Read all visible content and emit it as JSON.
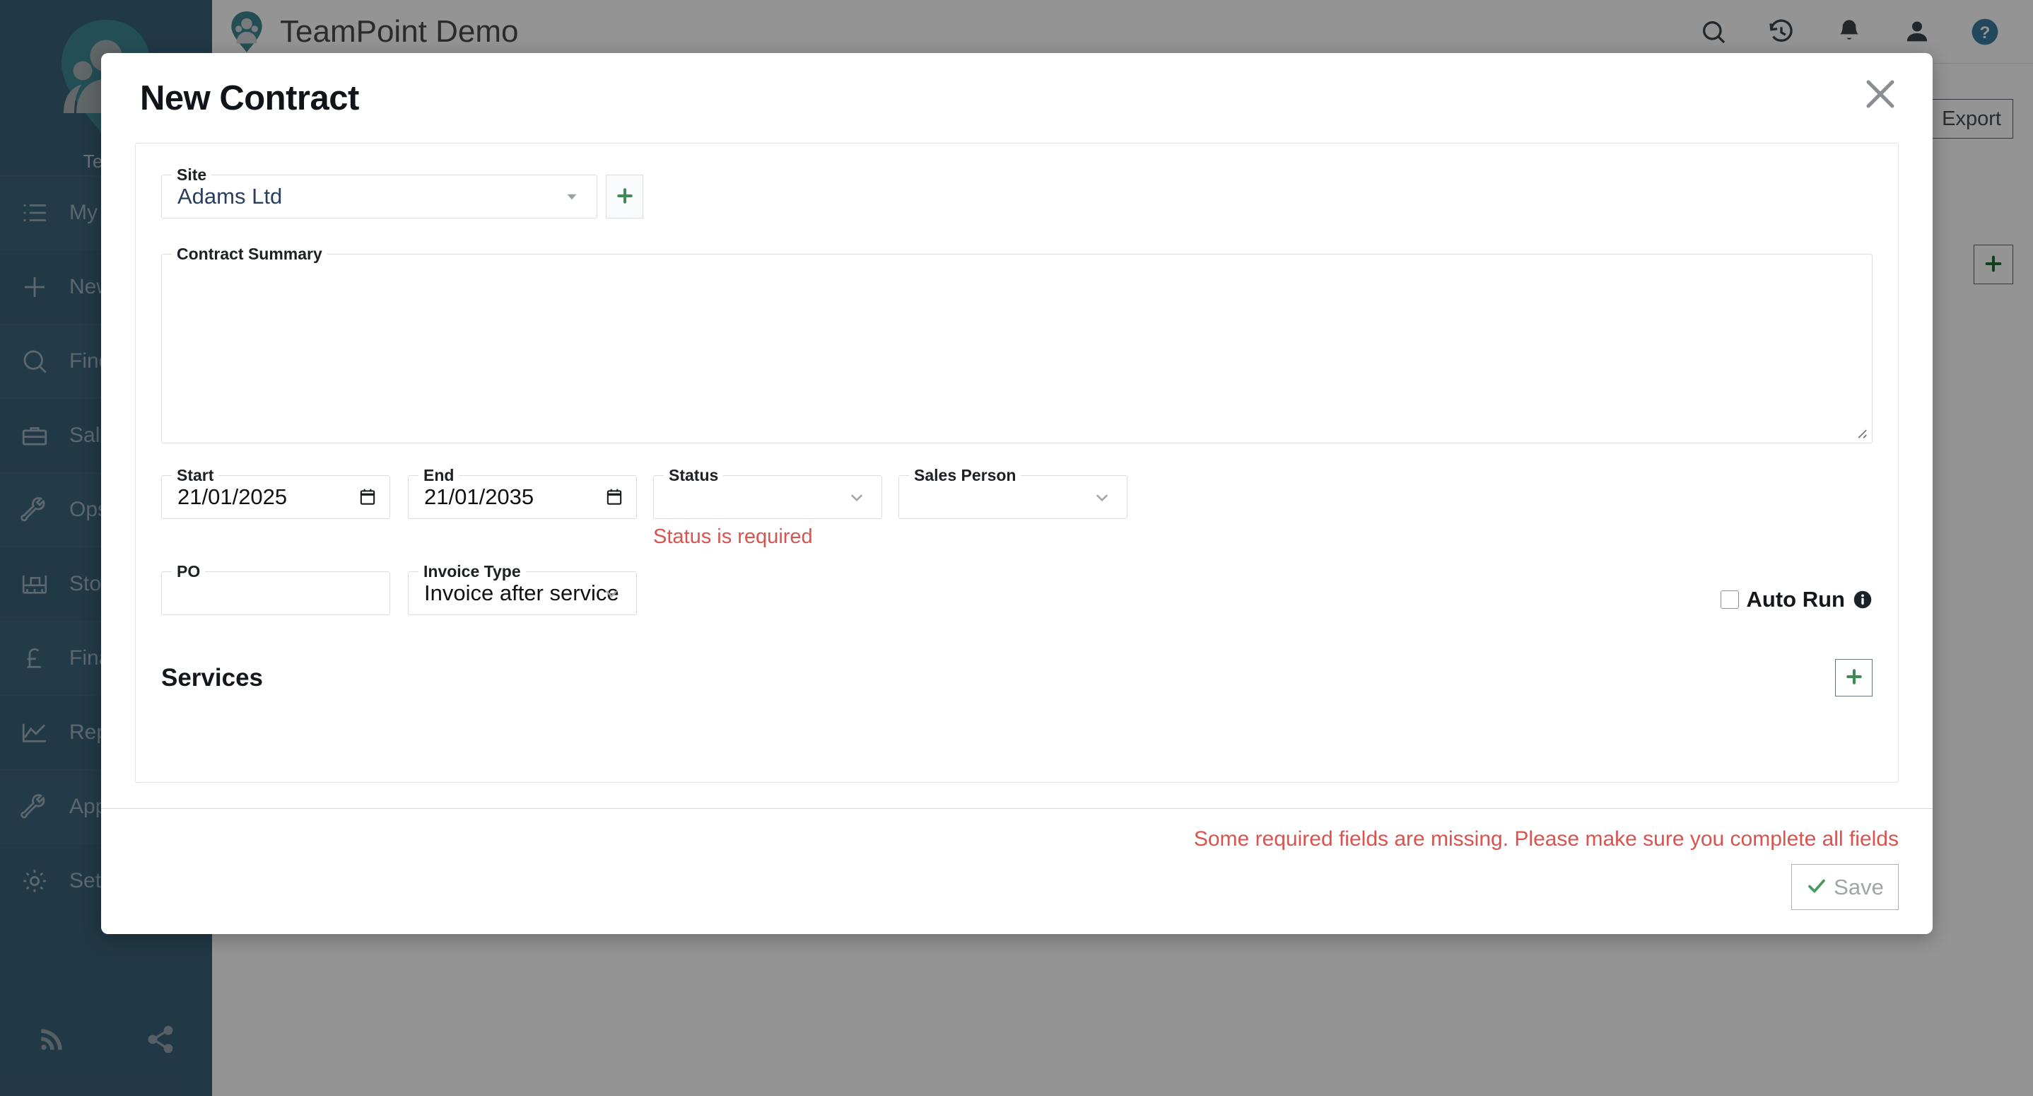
{
  "app": {
    "brand_name": "Team",
    "title": "TeamPoint Demo",
    "logo_icon": "people-pin-logo",
    "header_icons": [
      {
        "name": "search-icon",
        "label": "Search"
      },
      {
        "name": "history-icon",
        "label": "History"
      },
      {
        "name": "notifications-bell-icon",
        "label": "Notifications"
      },
      {
        "name": "user-account-icon",
        "label": "Account"
      },
      {
        "name": "help-icon",
        "label": "Help"
      }
    ],
    "accent_teal": "#3f8794",
    "sidebar_bg": "#3a6179",
    "help_icon_color": "#3a7ca0"
  },
  "sidebar": {
    "items": [
      {
        "label": "My N",
        "icon": "list-icon"
      },
      {
        "label": "New",
        "icon": "plus-icon"
      },
      {
        "label": "Find",
        "icon": "search-icon"
      },
      {
        "label": "Sale",
        "icon": "briefcase-icon"
      },
      {
        "label": "Ops",
        "icon": "wrench-icon"
      },
      {
        "label": "Stoc",
        "icon": "shelf-icon"
      },
      {
        "label": "Fina",
        "icon": "pound-sterling-icon"
      },
      {
        "label": "Repo",
        "icon": "chart-area-icon"
      },
      {
        "label": "App",
        "icon": "wrench-icon"
      },
      {
        "label": "Setti",
        "icon": "gear-icon"
      }
    ],
    "footer_icons": [
      {
        "name": "rss-feed-icon"
      },
      {
        "name": "share-icon"
      }
    ]
  },
  "background_page": {
    "export_label": "Export",
    "export_icon": "download-icon",
    "add_button_icon": "plus-icon"
  },
  "modal": {
    "title": "New Contract",
    "close_icon": "close-icon",
    "site": {
      "label": "Site",
      "value": "Adams Ltd",
      "dropdown_icon": "caret-down-icon",
      "add_icon": "plus-icon"
    },
    "contract_summary": {
      "label": "Contract Summary",
      "value": "",
      "resize_handle": "resize-grip"
    },
    "start": {
      "label": "Start",
      "value": "21/01/2025",
      "icon": "calendar-icon"
    },
    "end": {
      "label": "End",
      "value": "21/01/2035",
      "icon": "calendar-icon"
    },
    "status": {
      "label": "Status",
      "value": "",
      "dropdown_icon": "chevron-down-icon",
      "error": "Status is required"
    },
    "sales_person": {
      "label": "Sales Person",
      "value": "",
      "dropdown_icon": "chevron-down-icon"
    },
    "po": {
      "label": "PO",
      "value": ""
    },
    "invoice_type": {
      "label": "Invoice Type",
      "value": "Invoice after service",
      "dropdown_icon": "chevron-down-icon"
    },
    "auto_run": {
      "label": "Auto Run",
      "checked": false,
      "info_icon": "info-icon"
    },
    "services": {
      "title": "Services",
      "add_icon": "plus-icon"
    },
    "footer": {
      "error": "Some required fields are missing. Please make sure you complete all fields",
      "save_label": "Save",
      "save_icon": "check-icon",
      "save_disabled": true
    }
  },
  "colors": {
    "error_red": "#d9534f",
    "green": "#3e8a55",
    "disabled_gray": "#a0a5aa"
  }
}
